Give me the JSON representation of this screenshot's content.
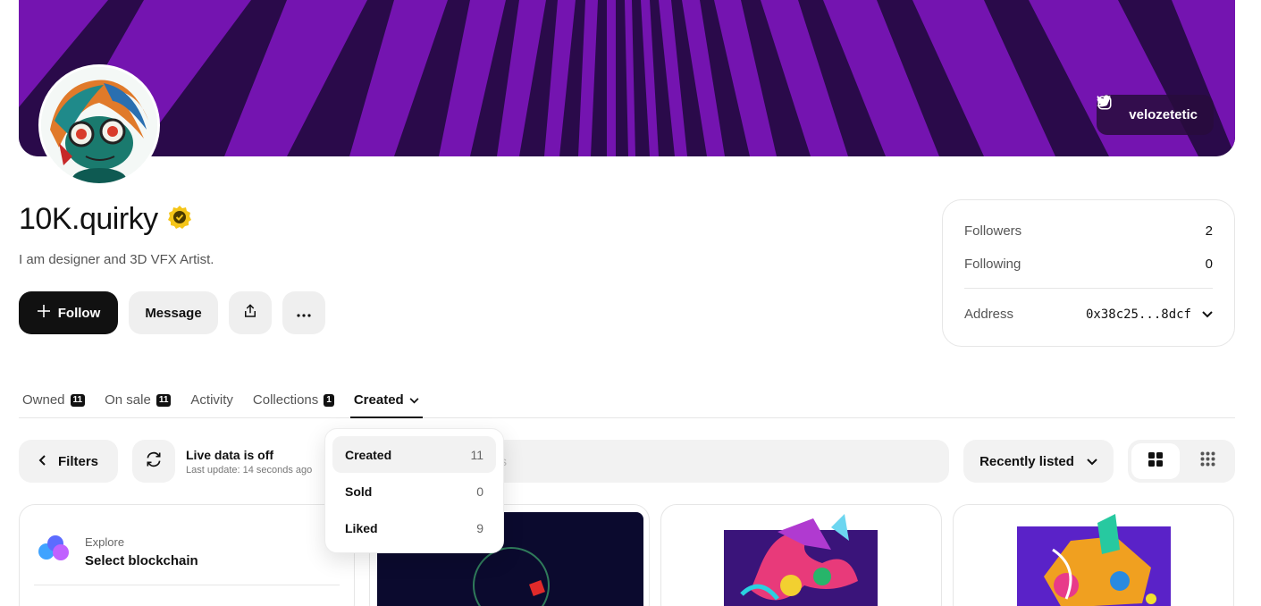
{
  "profile": {
    "name": "10K.quirky",
    "bio": "I am designer and 3D VFX Artist.",
    "social_handle": "velozetetic"
  },
  "actions": {
    "follow_label": "Follow",
    "message_label": "Message"
  },
  "stats": {
    "followers_label": "Followers",
    "followers_value": "2",
    "following_label": "Following",
    "following_value": "0",
    "address_label": "Address",
    "address_value": "0x38c25...8dcf"
  },
  "tabs": [
    {
      "label": "Owned",
      "count": "11"
    },
    {
      "label": "On sale",
      "count": "11"
    },
    {
      "label": "Activity"
    },
    {
      "label": "Collections",
      "count": "1"
    },
    {
      "label": "Created"
    }
  ],
  "toolbar": {
    "filters_label": "Filters",
    "live_title": "Live data is off",
    "live_subtitle": "Last update: 14 seconds ago",
    "search_placeholder": "s",
    "sort_label": "Recently listed"
  },
  "dropdown": {
    "items": [
      {
        "label": "Created",
        "count": "11"
      },
      {
        "label": "Sold",
        "count": "0"
      },
      {
        "label": "Liked",
        "count": "9"
      }
    ]
  },
  "chain_card": {
    "kicker": "Explore",
    "title": "Select blockchain"
  },
  "colors": {
    "banner_purple": "#7414b0",
    "banner_dark": "#2a0a4a",
    "verified": "#f5c518",
    "primary_button": "#111111"
  },
  "icons": [
    "instagram-icon",
    "twitter-icon",
    "verified-badge-icon",
    "plus-icon",
    "share-icon",
    "more-icon",
    "chevron-down-icon",
    "chevron-left-icon",
    "refresh-icon",
    "grid-large-icon",
    "grid-small-icon",
    "blockchain-logo-icon"
  ]
}
